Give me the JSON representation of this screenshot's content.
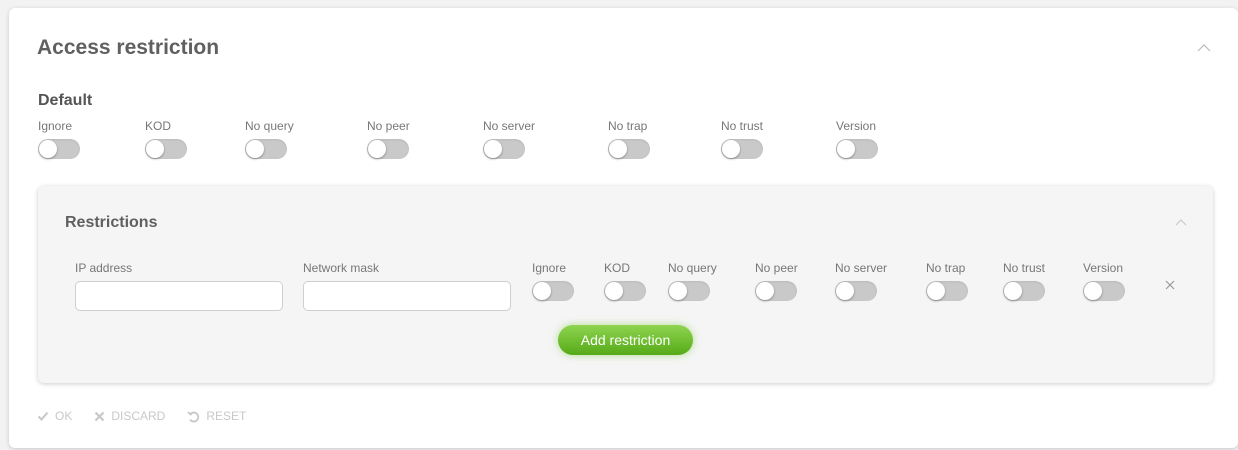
{
  "panel": {
    "title": "Access restriction",
    "default_heading": "Default",
    "default_toggles": [
      {
        "label": "Ignore",
        "on": false
      },
      {
        "label": "KOD",
        "on": false
      },
      {
        "label": "No query",
        "on": false
      },
      {
        "label": "No peer",
        "on": false
      },
      {
        "label": "No server",
        "on": false
      },
      {
        "label": "No trap",
        "on": false
      },
      {
        "label": "No trust",
        "on": false
      },
      {
        "label": "Version",
        "on": false
      }
    ]
  },
  "restrictions": {
    "title": "Restrictions",
    "ip_label": "IP address",
    "ip_value": "",
    "mask_label": "Network mask",
    "mask_value": "",
    "toggles": [
      {
        "label": "Ignore",
        "on": false
      },
      {
        "label": "KOD",
        "on": false
      },
      {
        "label": "No query",
        "on": false
      },
      {
        "label": "No peer",
        "on": false
      },
      {
        "label": "No server",
        "on": false
      },
      {
        "label": "No trap",
        "on": false
      },
      {
        "label": "No trust",
        "on": false
      },
      {
        "label": "Version",
        "on": false
      }
    ],
    "add_button": "Add restriction"
  },
  "actions": {
    "ok": "OK",
    "discard": "DISCARD",
    "reset": "RESET"
  },
  "colors": {
    "accent_green": "#6cc12b",
    "toggle_off": "#c9c9c9",
    "disabled_text": "#c8c8c8"
  }
}
